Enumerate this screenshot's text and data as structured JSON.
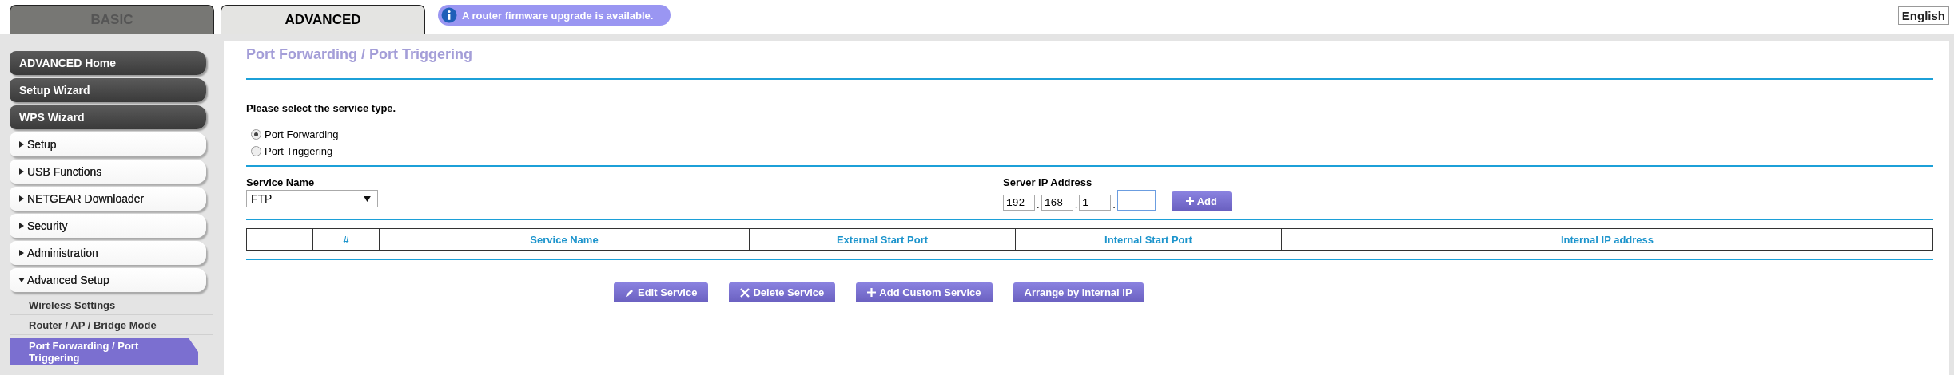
{
  "tabs": [
    {
      "label": "BASIC",
      "selected": false
    },
    {
      "label": "ADVANCED",
      "selected": true
    }
  ],
  "notice": "A router firmware upgrade is available.",
  "language": "English",
  "sidebar": {
    "items": [
      {
        "kind": "main",
        "label": "ADVANCED Home"
      },
      {
        "kind": "main",
        "label": "Setup Wizard"
      },
      {
        "kind": "main",
        "label": "WPS Wizard"
      },
      {
        "kind": "section",
        "label": "Setup",
        "expanded": false
      },
      {
        "kind": "section",
        "label": "USB Functions",
        "expanded": false
      },
      {
        "kind": "section",
        "label": "NETGEAR Downloader",
        "expanded": false
      },
      {
        "kind": "section",
        "label": "Security",
        "expanded": false
      },
      {
        "kind": "section",
        "label": "Administration",
        "expanded": false
      },
      {
        "kind": "section",
        "label": "Advanced Setup",
        "expanded": true
      },
      {
        "kind": "link",
        "label": "Wireless Settings",
        "selected": false
      },
      {
        "kind": "link",
        "label": "Router / AP / Bridge Mode",
        "selected": false
      },
      {
        "kind": "link",
        "label": "Port Forwarding / Port Triggering",
        "selected": true
      }
    ]
  },
  "page_title": "Port Forwarding / Port Triggering",
  "prompt": "Please select the service type.",
  "service_types": [
    {
      "label": "Port Forwarding",
      "selected": true
    },
    {
      "label": "Port Triggering",
      "selected": false
    }
  ],
  "service_name": {
    "label": "Service Name",
    "value": "FTP"
  },
  "server_ip": {
    "label": "Server IP Address",
    "octets": [
      "192",
      "168",
      "1"
    ],
    "separator": "."
  },
  "add_button": "Add",
  "table": {
    "columns": [
      "#",
      "Service Name",
      "External Start Port",
      "Internal Start Port",
      "Internal IP address"
    ]
  },
  "actions": [
    {
      "kind": "edit",
      "label": "Edit Service"
    },
    {
      "kind": "delete",
      "label": "Delete Service"
    },
    {
      "kind": "add",
      "label": "Add Custom Service"
    },
    {
      "kind": "plain",
      "label": "Arrange by Internal IP"
    }
  ]
}
